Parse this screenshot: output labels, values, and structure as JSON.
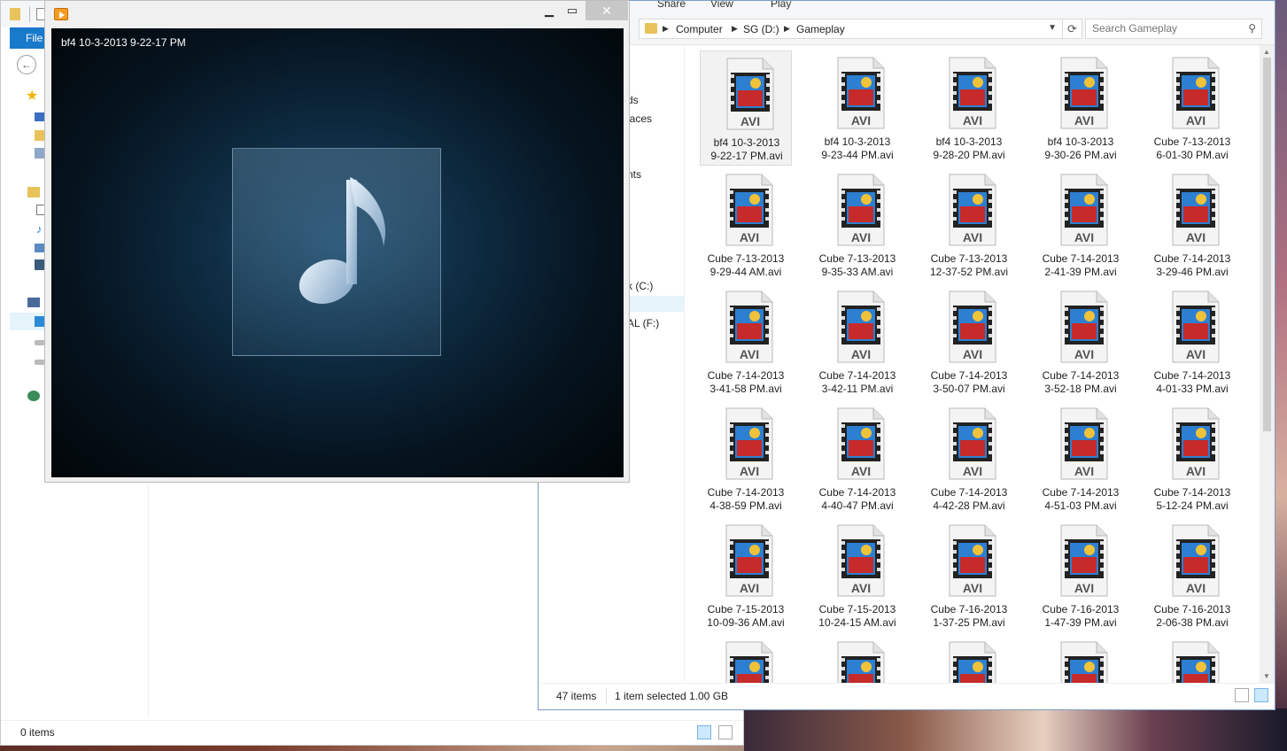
{
  "explorer": {
    "ribbon_tabs": [
      "Share",
      "View",
      "Play"
    ],
    "breadcrumb": [
      "Computer",
      "SG (D:)",
      "Gameplay"
    ],
    "search_placeholder": "Search Gameplay",
    "nav_fragments": [
      "ds",
      "laces",
      "nts",
      "k (C:)",
      "AL (F:)"
    ],
    "files": [
      {
        "line1": "bf4 10-3-2013",
        "line2": "9-22-17 PM.avi",
        "selected": true
      },
      {
        "line1": "bf4 10-3-2013",
        "line2": "9-23-44 PM.avi"
      },
      {
        "line1": "bf4 10-3-2013",
        "line2": "9-28-20 PM.avi"
      },
      {
        "line1": "bf4 10-3-2013",
        "line2": "9-30-26 PM.avi"
      },
      {
        "line1": "Cube 7-13-2013",
        "line2": "6-01-30 PM.avi"
      },
      {
        "line1": "Cube 7-13-2013",
        "line2": "9-29-44 AM.avi"
      },
      {
        "line1": "Cube 7-13-2013",
        "line2": "9-35-33 AM.avi"
      },
      {
        "line1": "Cube 7-13-2013",
        "line2": "12-37-52 PM.avi"
      },
      {
        "line1": "Cube 7-14-2013",
        "line2": "2-41-39 PM.avi"
      },
      {
        "line1": "Cube 7-14-2013",
        "line2": "3-29-46 PM.avi"
      },
      {
        "line1": "Cube 7-14-2013",
        "line2": "3-41-58 PM.avi"
      },
      {
        "line1": "Cube 7-14-2013",
        "line2": "3-42-11 PM.avi"
      },
      {
        "line1": "Cube 7-14-2013",
        "line2": "3-50-07 PM.avi"
      },
      {
        "line1": "Cube 7-14-2013",
        "line2": "3-52-18 PM.avi"
      },
      {
        "line1": "Cube 7-14-2013",
        "line2": "4-01-33 PM.avi"
      },
      {
        "line1": "Cube 7-14-2013",
        "line2": "4-38-59 PM.avi"
      },
      {
        "line1": "Cube 7-14-2013",
        "line2": "4-40-47 PM.avi"
      },
      {
        "line1": "Cube 7-14-2013",
        "line2": "4-42-28 PM.avi"
      },
      {
        "line1": "Cube 7-14-2013",
        "line2": "4-51-03 PM.avi"
      },
      {
        "line1": "Cube 7-14-2013",
        "line2": "5-12-24 PM.avi"
      },
      {
        "line1": "Cube 7-15-2013",
        "line2": "10-09-36 AM.avi"
      },
      {
        "line1": "Cube 7-15-2013",
        "line2": "10-24-15 AM.avi"
      },
      {
        "line1": "Cube 7-16-2013",
        "line2": "1-37-25 PM.avi"
      },
      {
        "line1": "Cube 7-16-2013",
        "line2": "1-47-39 PM.avi"
      },
      {
        "line1": "Cube 7-16-2013",
        "line2": "2-06-38 PM.avi"
      },
      {
        "line1": "",
        "line2": ""
      },
      {
        "line1": "",
        "line2": ""
      },
      {
        "line1": "",
        "line2": ""
      },
      {
        "line1": "",
        "line2": ""
      },
      {
        "line1": "",
        "line2": ""
      }
    ],
    "file_type_label": "AVI",
    "status": {
      "item_count": "47 items",
      "selection": "1 item selected",
      "size": "1.00 GB"
    }
  },
  "left_window": {
    "file_tab": "File",
    "status_items": "0 items"
  },
  "player": {
    "now_playing": "bf4 10-3-2013 9-22-17 PM",
    "minimize": "▁",
    "maximize": "▭",
    "close": "✕"
  },
  "colors": {
    "accent": "#1979ca",
    "selection": "#e5f3fb",
    "player_bg": "#061420"
  }
}
